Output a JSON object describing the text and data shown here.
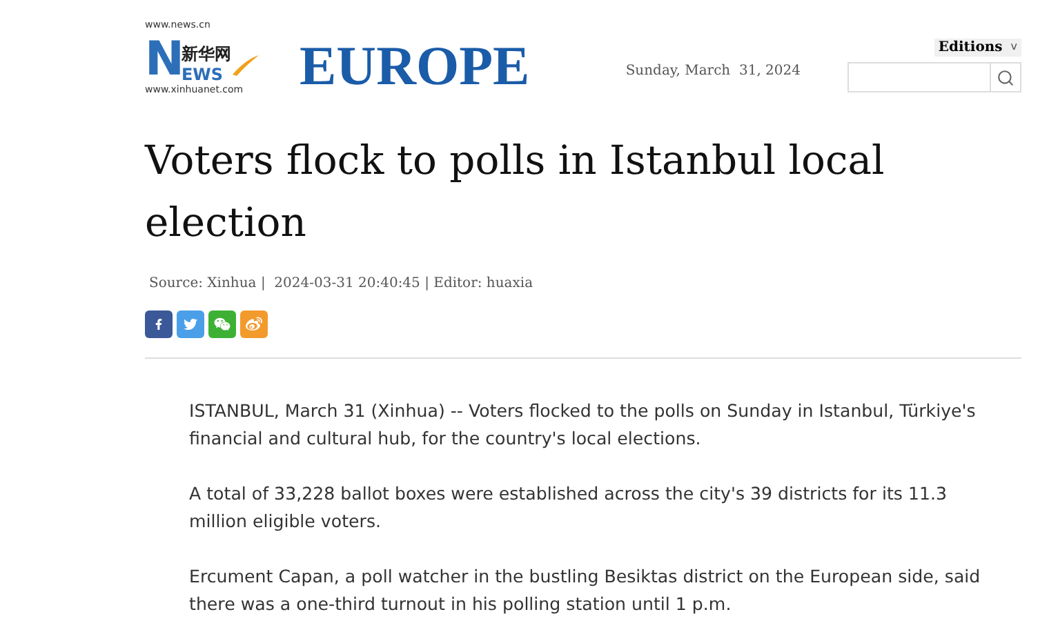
{
  "logo": {
    "top": "www.news.cn",
    "big_letter": "N",
    "ews": "EWS",
    "chinese": "新华网",
    "bottom": "www.xinhuanet.com"
  },
  "section": "EUROPE",
  "date": "Sunday, March  31, 2024",
  "editions": {
    "label": "Editions",
    "caret": "v"
  },
  "headline": "Voters flock to polls in Istanbul local election",
  "byline": "Source: Xinhua |  2024-03-31 20:40:45 | Editor: huaxia",
  "share_buttons": [
    {
      "kind": "facebook",
      "color": "#3b5998"
    },
    {
      "kind": "twitter",
      "color": "#4a9fe8"
    },
    {
      "kind": "wechat",
      "color": "#3eb135"
    },
    {
      "kind": "weibo",
      "color": "#f39a2c"
    }
  ],
  "paragraphs": [
    "ISTANBUL, March 31 (Xinhua) -- Voters flocked to the polls on Sunday in Istanbul, Türkiye's financial and cultural hub, for the country's local elections.",
    "A total of 33,228 ballot boxes were established across the city's 39 districts for its 11.3 million eligible voters.",
    "Ercument Capan, a poll watcher in the bustling Besiktas district on the European side, said there was a one-third turnout in his polling station until 1 p.m."
  ]
}
